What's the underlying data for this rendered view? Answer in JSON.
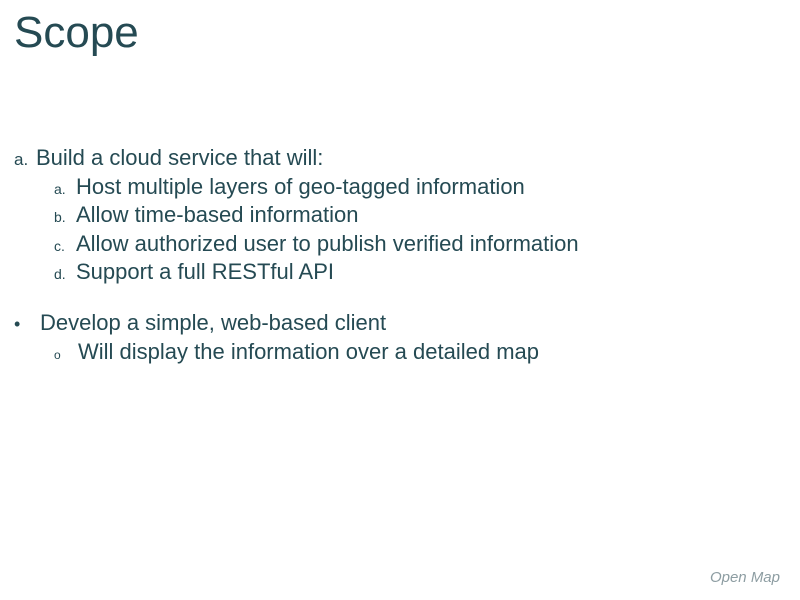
{
  "title": "Scope",
  "item1": {
    "marker": "a.",
    "text": "Build a cloud service that will:",
    "sub": [
      {
        "marker": "a.",
        "text": "Host multiple layers of geo-tagged information"
      },
      {
        "marker": "b.",
        "text": "Allow time-based information"
      },
      {
        "marker": "c.",
        "text": "Allow authorized user to publish verified information"
      },
      {
        "marker": "d.",
        "text": "Support a full RESTful API"
      }
    ]
  },
  "item2": {
    "marker": "•",
    "text": "Develop a simple, web-based client",
    "sub": [
      {
        "marker": "o",
        "text": "Will display the information over a detailed map"
      }
    ]
  },
  "footer": "Open Map"
}
